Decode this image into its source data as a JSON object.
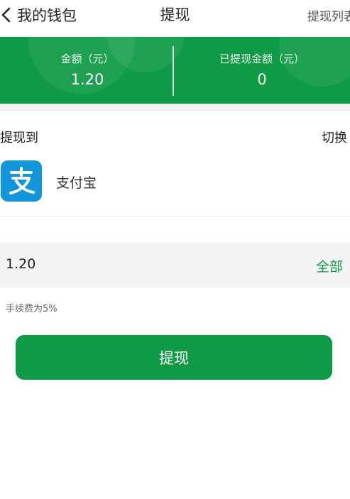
{
  "nav": {
    "back_label": "我的钱包",
    "title": "提现",
    "right_label": "提现列表"
  },
  "balance": {
    "amount_label": "金额（元）",
    "amount_value": "1.20",
    "withdrawn_label": "已提现金额（元）",
    "withdrawn_value": "0"
  },
  "withdraw_to": {
    "label": "提现到",
    "switch_label": "切换",
    "method_name": "支付宝",
    "method_icon": "alipay-icon"
  },
  "amount_input": {
    "value": "1.20",
    "all_label": "全部"
  },
  "fee_note": "手续费为5%",
  "submit_label": "提现",
  "colors": {
    "primary_green": "#0f9a45",
    "alipay_blue": "#1296db"
  }
}
